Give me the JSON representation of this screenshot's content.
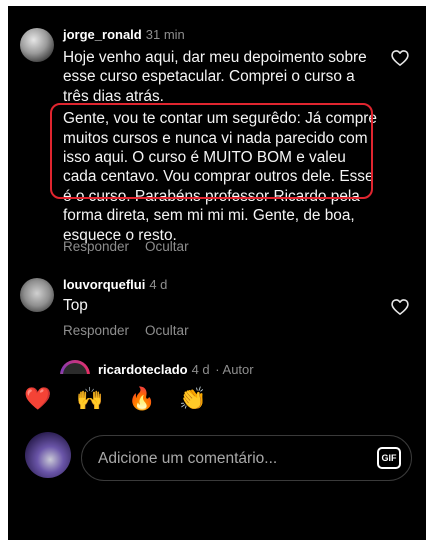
{
  "comments": [
    {
      "username": "jorge_ronald",
      "time": "31 min",
      "paragraph1": "Hoje venho aqui, dar meu depoimento sobre esse curso espetacular. Comprei o curso a três dias atrás.",
      "paragraph2": "Gente, vou te contar um segurêdo: Já compre muitos cursos e nunca vi nada parecido com isso aqui. O curso é MUITO BOM e valeu cada centavo. Vou comprar outros dele. Esse é o curso. Parabéns professor Ricardo pela forma direta, sem mi mi mi. Gente, de boa, esquece o resto.",
      "reply_label": "Responder",
      "hide_label": "Ocultar"
    },
    {
      "username": "louvorqueflui",
      "time": "4 d",
      "text": "Top",
      "reply_label": "Responder",
      "hide_label": "Ocultar"
    },
    {
      "username": "ricardoteclado",
      "time": "4 d",
      "badge": "· Autor"
    }
  ],
  "emoji_bar": [
    "❤️",
    "🙌",
    "🔥",
    "👏",
    "😢",
    "😍",
    "😮",
    "😂"
  ],
  "composer": {
    "placeholder": "Adicione um comentário...",
    "gif_label": "GIF"
  },
  "colors": {
    "background": "#000000",
    "text": "#f5f5f5",
    "muted": "#8e8e8e",
    "highlight_border": "#e0252f"
  }
}
